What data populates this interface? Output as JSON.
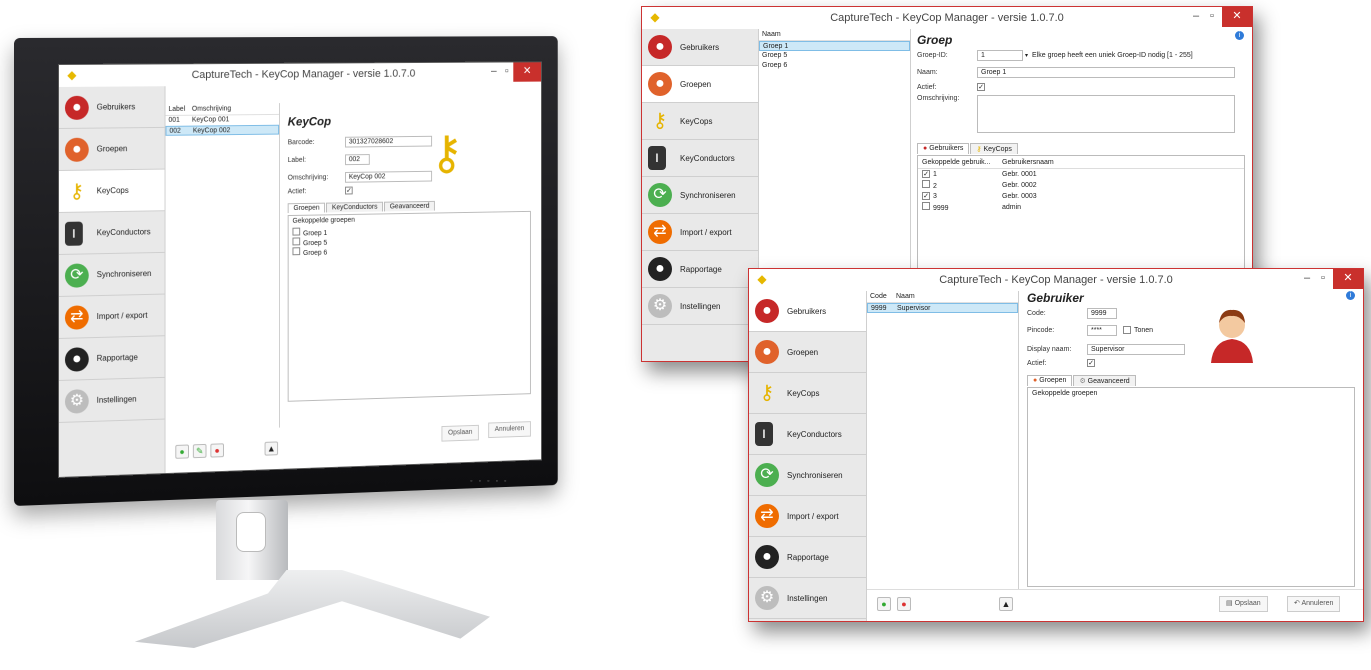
{
  "app": {
    "title": "CaptureTech - KeyCop Manager - versie 1.0.7.0",
    "nav": [
      "Gebruikers",
      "Groepen",
      "KeyCops",
      "KeyConductors",
      "Synchroniseren",
      "Import / export",
      "Rapportage",
      "Instellingen"
    ]
  },
  "monitor": {
    "list_headers": [
      "Label",
      "Omschrijving"
    ],
    "rows": [
      [
        "001",
        "KeyCop 001"
      ],
      [
        "002",
        "KeyCop 002"
      ]
    ],
    "form_title": "KeyCop",
    "labels": {
      "barcode": "Barcode:",
      "label": "Label:",
      "omschrijving": "Omschrijving:",
      "actief": "Actief:"
    },
    "values": {
      "barcode": "301327028602",
      "label": "002",
      "omschrijving": "KeyCop 002"
    },
    "tabs": [
      "Groepen",
      "KeyConductors",
      "Geavanceerd"
    ],
    "panel_header": "Gekoppelde groepen",
    "groups": [
      "Groep 1",
      "Groep 5",
      "Groep 6"
    ],
    "save": "Opslaan",
    "cancel": "Annuleren"
  },
  "groep": {
    "list_header": "Naam",
    "rows": [
      "Groep 1",
      "Groep 5",
      "Groep 6"
    ],
    "form_title": "Groep",
    "labels": {
      "id": "Groep-ID:",
      "naam": "Naam:",
      "actief": "Actief:",
      "omschrijving": "Omschrijving:"
    },
    "values": {
      "id": "1",
      "hint": "Elke groep heeft een uniek Groep-ID nodig [1 - 255]",
      "naam": "Groep 1"
    },
    "tabs": [
      "Gebruikers",
      "KeyCops"
    ],
    "col_headers": [
      "Gekoppelde gebruik...",
      "Gebruikersnaam"
    ],
    "users": [
      [
        "1",
        "Gebr. 0001"
      ],
      [
        "2",
        "Gebr. 0002"
      ],
      [
        "3",
        "Gebr. 0003"
      ],
      [
        "9999",
        "admin"
      ]
    ],
    "user_checked": [
      true,
      false,
      true,
      false
    ]
  },
  "gebruiker": {
    "list_headers": [
      "Code",
      "Naam"
    ],
    "rows": [
      [
        "9999",
        "Supervisor"
      ]
    ],
    "form_title": "Gebruiker",
    "labels": {
      "code": "Code:",
      "pincode": "Pincode:",
      "tonen": "Tonen",
      "display": "Display naam:",
      "actief": "Actief:"
    },
    "values": {
      "code": "9999",
      "pincode": "****",
      "display": "Supervisor"
    },
    "tabs": [
      "Groepen",
      "Geavanceerd"
    ],
    "panel_header": "Gekoppelde groepen",
    "save": "Opslaan",
    "cancel": "Annuleren"
  }
}
